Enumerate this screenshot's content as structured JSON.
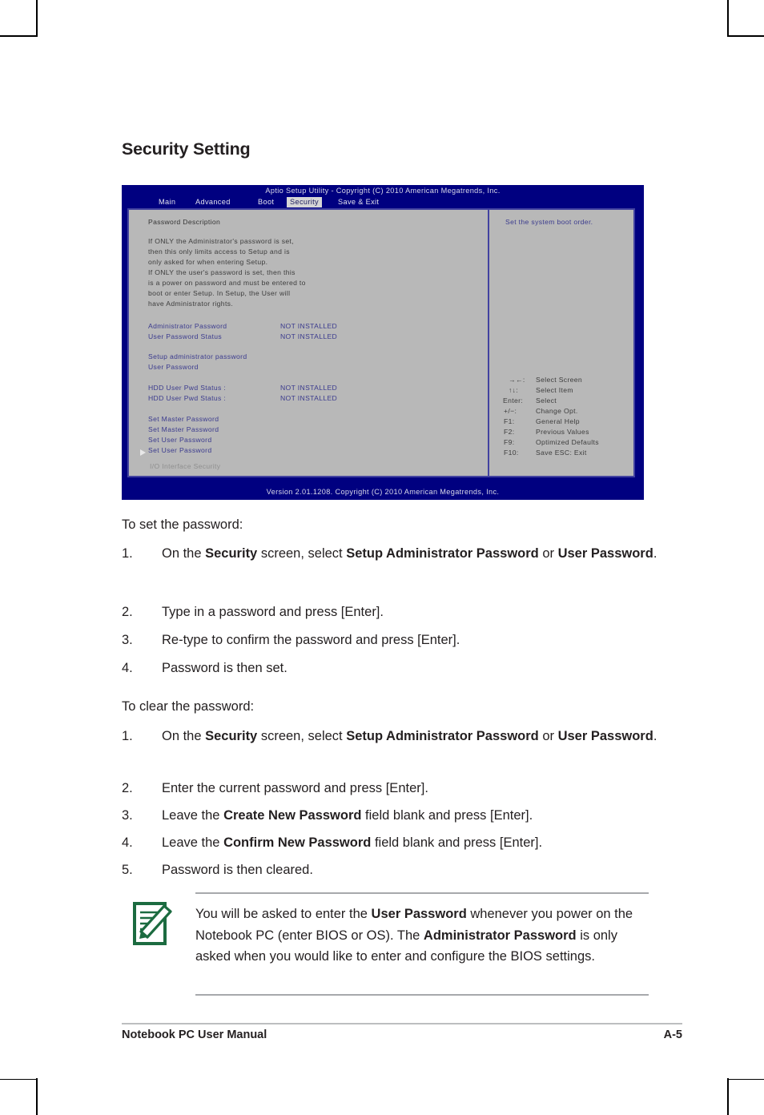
{
  "page": {
    "title": "Security Setting"
  },
  "bios": {
    "title": "Aptio Setup Utility - Copyright (C) 2010 American Megatrends, Inc.",
    "version": "Version 2.01.1208. Copyright (C) 2010 American Megatrends, Inc.",
    "menu": [
      {
        "label": "Main",
        "active": false
      },
      {
        "label": "Advanced",
        "active": false
      },
      {
        "label": "Boot",
        "active": false
      },
      {
        "label": "Security",
        "active": true
      },
      {
        "label": "Save & Exit",
        "active": false
      }
    ],
    "section_heading": "Password Description",
    "description_lines": [
      "If ONLY the Administrator's password is set,",
      "then this only limits access to Setup and is",
      "only asked for when entering Setup.",
      "If ONLY the user's password is set, then this",
      "is a power on password and must be entered to",
      "boot or enter Setup. In Setup, the User will",
      "have Administrator rights."
    ],
    "status_rows": [
      {
        "label": "Administrator Password",
        "value": "NOT INSTALLED"
      },
      {
        "label": "User Password Status",
        "value": "NOT INSTALLED"
      }
    ],
    "action_rows": [
      {
        "label": "Setup administrator password"
      },
      {
        "label": "User Password"
      }
    ],
    "hdd_rows": [
      {
        "label": "HDD User Pwd Status :",
        "value": "NOT INSTALLED"
      },
      {
        "label": "HDD User Pwd Status :",
        "value": "NOT INSTALLED"
      }
    ],
    "password_rows": [
      {
        "label": "Set Master Password"
      },
      {
        "label": "Set Master Password"
      },
      {
        "label": "Set User Password"
      },
      {
        "label": "Set User Password"
      }
    ],
    "submenu": {
      "label": "I/O Interface Security"
    },
    "help_text": "Set the system boot order.",
    "key_help": [
      {
        "key": "→←:",
        "desc": "Select Screen"
      },
      {
        "key": "↑↓:",
        "desc": "Select Item"
      },
      {
        "key": "Enter:",
        "desc": "Select"
      },
      {
        "key": "+/−:",
        "desc": "Change Opt."
      },
      {
        "key": "F1:",
        "desc": "General Help"
      },
      {
        "key": "F2:",
        "desc": "Previous Values"
      },
      {
        "key": "F9:",
        "desc": "Optimized Defaults"
      },
      {
        "key": "F10:",
        "desc": "Save    ESC:  Exit"
      }
    ],
    "colors": {
      "window_bg": "#000080",
      "panel_bg": "#b8b8b8",
      "panel_border": "#4242a0",
      "label_text": "#3b3b8e",
      "active_tab_bg": "#d6d6d6"
    }
  },
  "set_password": {
    "heading": "To set the password:",
    "steps": [
      {
        "num": "1.",
        "html": "On the <b>Security</b> screen, select <b>Setup Administrator Password</b> or <b>User Password</b>."
      },
      {
        "num": "2.",
        "html": "Type in a password and press [Enter]."
      },
      {
        "num": "3.",
        "html": "Re-type to confirm the password and press [Enter]."
      },
      {
        "num": "4.",
        "html": "Password is then set."
      }
    ]
  },
  "clear_password": {
    "heading": "To clear the password:",
    "steps": [
      {
        "num": "1.",
        "html": "On the <b>Security</b> screen, select <b>Setup Administrator Password</b> or <b>User Password</b>."
      },
      {
        "num": "2.",
        "html": "Enter the current password and press [Enter]."
      },
      {
        "num": "3.",
        "html": "Leave the <b>Create New Password</b> field blank and press [Enter]."
      },
      {
        "num": "4.",
        "html": "Leave the <b>Confirm New Password</b> field blank and press [Enter]."
      },
      {
        "num": "5.",
        "html": "Password is then cleared."
      }
    ]
  },
  "note": {
    "icon": "note-pencil-icon",
    "icon_color": "#1c6b40",
    "html": "You will be asked to enter the <b>User Password</b> whenever you power on the Notebook PC (enter BIOS or OS). The <b>Administrator Password</b> is only asked when you would like to enter and configure the BIOS settings."
  },
  "footer": {
    "left": "Notebook PC User Manual",
    "right": "A-5"
  }
}
